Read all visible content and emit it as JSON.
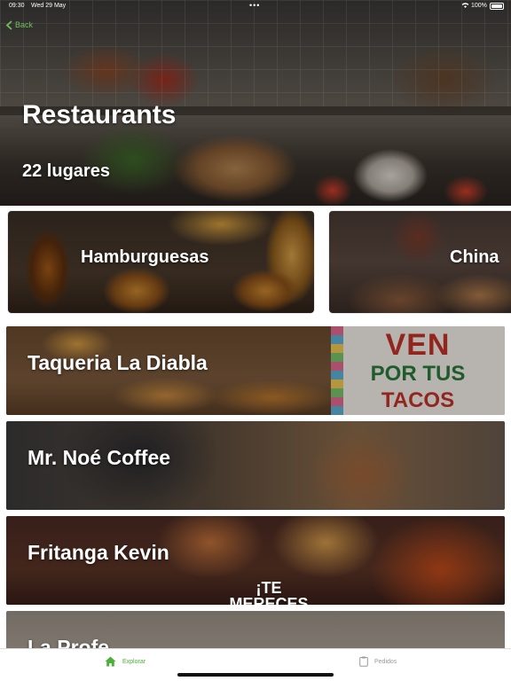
{
  "status_bar": {
    "time": "09:30",
    "date": "Wed 29 May",
    "dots": "•••",
    "battery": "100%"
  },
  "nav": {
    "back_label": "Back",
    "back_icon": "chevron-left-icon",
    "accent_color": "#6fc05a"
  },
  "header": {
    "title": "Restaurants",
    "subtitle": "22 lugares"
  },
  "categories": [
    {
      "label": "Hamburguesas"
    },
    {
      "label": "China"
    }
  ],
  "restaurants": [
    {
      "name": "Taqueria La Diabla",
      "poster": [
        "VEN",
        "POR TUS",
        "TACOS"
      ]
    },
    {
      "name": "Mr. Noé Coffee"
    },
    {
      "name": "Fritanga Kevin",
      "sticker": [
        "¡TE",
        "MERECES"
      ]
    },
    {
      "name": "La Profe"
    }
  ],
  "tab_bar": {
    "tabs": [
      {
        "label": "Explorar",
        "icon": "home-icon",
        "active": true,
        "color": "#4caf3a"
      },
      {
        "label": "Pedidos",
        "icon": "clipboard-icon",
        "active": false,
        "color": "#9a9a9a"
      }
    ]
  }
}
